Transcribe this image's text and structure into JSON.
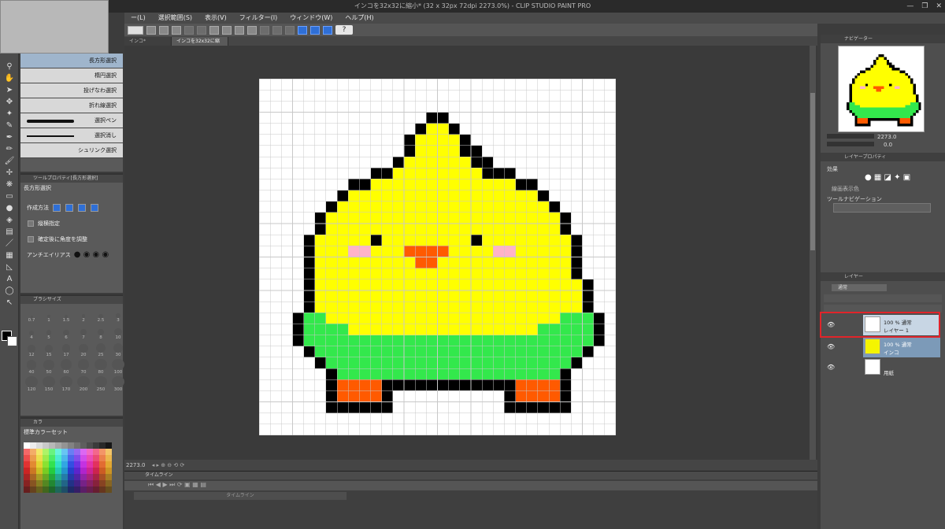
{
  "window": {
    "title": "インコを32x32に縮小* (32 x 32px 72dpi 2273.0%)  - CLIP STUDIO PAINT PRO",
    "controls": [
      "—",
      "❐",
      "✕"
    ]
  },
  "menu": [
    "ー(L)",
    "選択範囲(S)",
    "表示(V)",
    "フィルター(I)",
    "ウィンドウ(W)",
    "ヘルプ(H)"
  ],
  "document_tabs": [
    "インコ*",
    "インコを32x32に縮小*"
  ],
  "help_label": "?",
  "subtool": {
    "items": [
      "長方形選択",
      "楕円選択",
      "投げなわ選択",
      "折れ線選択",
      "選択ペン",
      "選択消し",
      "シュリンク選択"
    ],
    "selected_index": 0
  },
  "tool_property": {
    "header": "ツールプロパティ[長方形選択]",
    "tool_name": "長方形選択",
    "mode_label": "作成方法",
    "aspect_label": "縦横指定",
    "angle_label": "確定後に角度を調整",
    "antialias_label": "アンチエイリアス"
  },
  "brush_size": {
    "header": "ブラシサイズ",
    "sizes": [
      "0.7",
      "1",
      "1.5",
      "2",
      "2.5",
      "3",
      "4",
      "5",
      "6",
      "7",
      "8",
      "10",
      "12",
      "15",
      "17",
      "20",
      "25",
      "30",
      "40",
      "50",
      "60",
      "70",
      "80",
      "100",
      "120",
      "150",
      "170",
      "200",
      "250",
      "300"
    ]
  },
  "color_set": {
    "header": "カラ",
    "set_name": "標準カラーセット"
  },
  "zoom": {
    "value": "2273.0"
  },
  "timeline": {
    "header": "タイムライン",
    "placeholder": "タイムライン"
  },
  "navigator": {
    "header": "ナビゲーター",
    "zoom": "2273.0",
    "angle": "0.0"
  },
  "layer_property": {
    "header": "レイヤープロパティ",
    "effect_label": "効果",
    "line_color_label": "線画表示色",
    "tool_nav_label": "ツールナビゲーション"
  },
  "layers_panel": {
    "header": "レイヤー",
    "blend": "通常",
    "items": [
      {
        "meta": "100 % 通常",
        "name": "レイヤー 1",
        "selected": true
      },
      {
        "meta": "100 % 通常",
        "name": "インコ",
        "selected": false
      },
      {
        "meta": "",
        "name": "用紙",
        "selected": false
      }
    ]
  },
  "colors": {
    "yellow": "#ffff00",
    "green": "#33e84c",
    "orange": "#ff5a00",
    "blush": "#ffb3c8",
    "highlight": "#e0242a"
  }
}
